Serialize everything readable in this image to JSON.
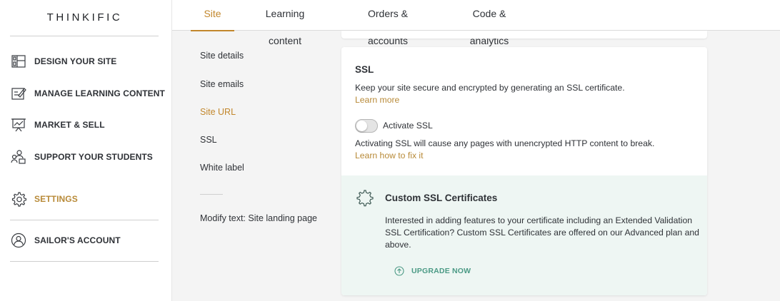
{
  "brand": {
    "logo_text": "THINKIFIC",
    "accent": "#c2872c",
    "teal": "#4b9a85"
  },
  "sidebar": {
    "items": [
      {
        "label": "DESIGN YOUR SITE",
        "icon": "layout-icon"
      },
      {
        "label": "MANAGE LEARNING CONTENT",
        "icon": "edit-icon"
      },
      {
        "label": "MARKET & SELL",
        "icon": "presentation-icon"
      },
      {
        "label": "SUPPORT YOUR STUDENTS",
        "icon": "people-icon"
      },
      {
        "label": "SETTINGS",
        "icon": "gear-icon",
        "active": true
      },
      {
        "label": "SAILOR'S ACCOUNT",
        "icon": "user-icon"
      }
    ]
  },
  "tabs": [
    {
      "label": "Site",
      "active": true
    },
    {
      "label": "Learning content"
    },
    {
      "label": "Orders & accounts"
    },
    {
      "label": "Code & analytics"
    }
  ],
  "subnav": {
    "items": [
      {
        "label": "Site details"
      },
      {
        "label": "Site emails"
      },
      {
        "label": "Site URL",
        "active": true
      },
      {
        "label": "SSL"
      },
      {
        "label": "White label"
      }
    ],
    "extra": "Modify text: Site landing page"
  },
  "ssl": {
    "title": "SSL",
    "description": "Keep your site secure and encrypted by generating an SSL certificate.",
    "learn_more": "Learn more",
    "toggle_label": "Activate SSL",
    "toggle_on": false,
    "warning": "Activating SSL will cause any pages with unencrypted HTTP content to break.",
    "fix_link": "Learn how to fix it"
  },
  "custom_ssl": {
    "title": "Custom SSL Certificates",
    "text": "Interested in adding features to your certificate including an Extended Validation SSL Certification? Custom SSL Certificates are offered on our Advanced plan and above.",
    "upgrade_label": "UPGRADE NOW",
    "icon": "gear-icon"
  }
}
